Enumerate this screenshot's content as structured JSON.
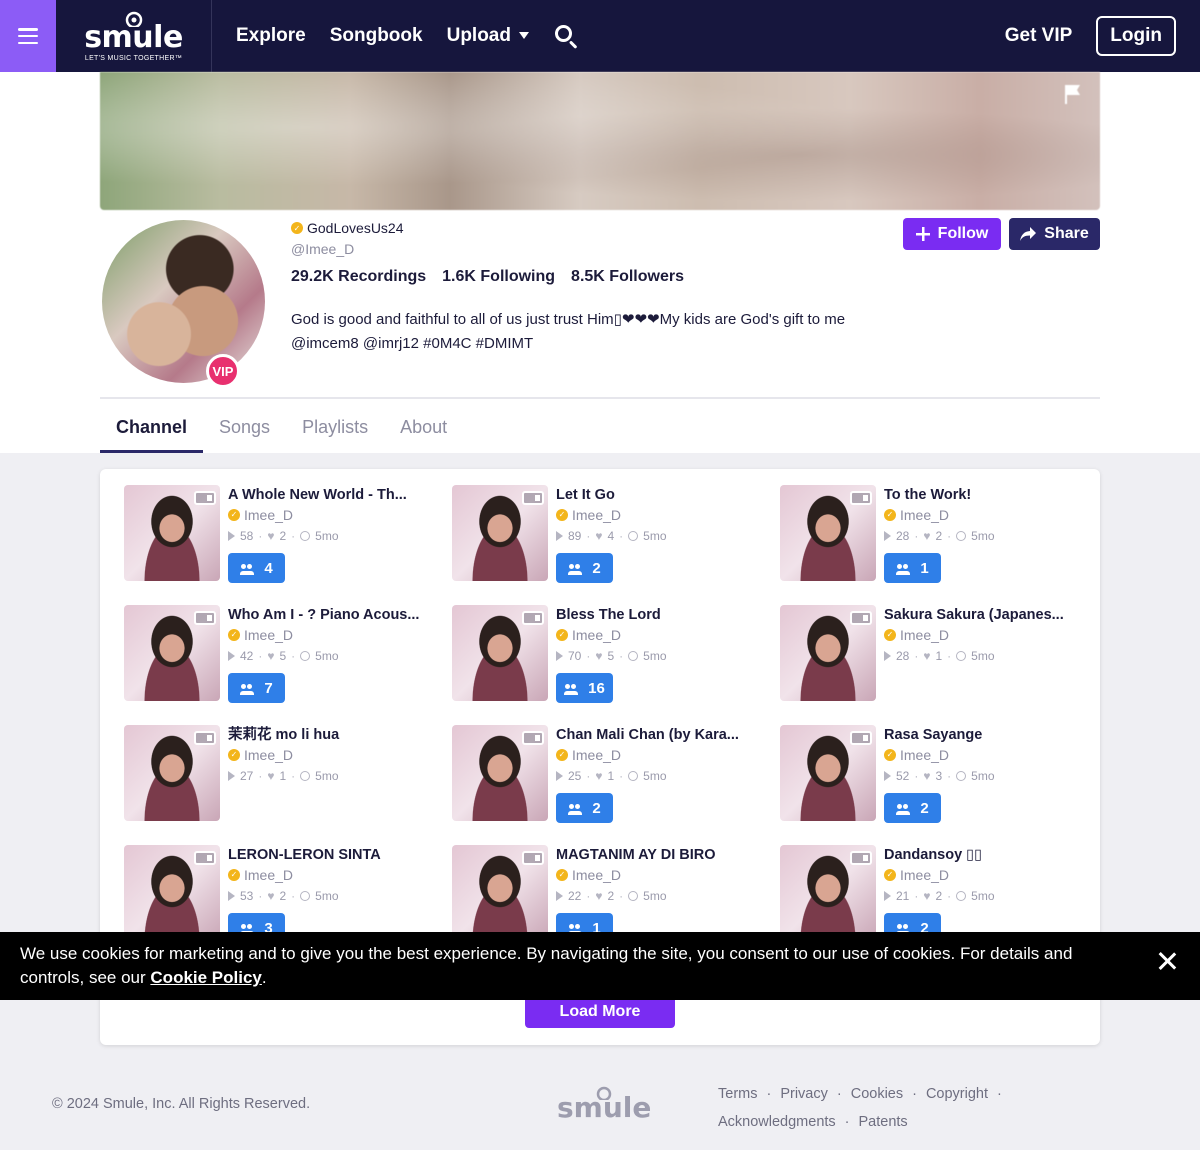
{
  "header": {
    "logo_word": "smule",
    "logo_tagline": "LET'S MUSIC TOGETHER™",
    "nav": {
      "explore": "Explore",
      "songbook": "Songbook",
      "upload": "Upload"
    },
    "get_vip": "Get VIP",
    "login": "Login"
  },
  "profile": {
    "display_name": "GodLovesUs24",
    "handle": "@Imee_D",
    "vip_badge": "VIP",
    "stats": {
      "recordings": "29.2K Recordings",
      "following": "1.6K Following",
      "followers": "8.5K Followers"
    },
    "bio": "God is good and faithful to all of us just trust Him▯❤❤❤My kids are God's gift to me @imcem8 @imrj12 #0M4C #DMIMT",
    "follow_label": "Follow",
    "share_label": "Share"
  },
  "tabs": [
    {
      "label": "Channel",
      "active": true
    },
    {
      "label": "Songs",
      "active": false
    },
    {
      "label": "Playlists",
      "active": false
    },
    {
      "label": "About",
      "active": false
    }
  ],
  "recordings": [
    {
      "title": "A Whole New World - Th...",
      "artist": "Imee_D",
      "plays": "58",
      "loves": "2",
      "age": "5mo",
      "collabs": "4"
    },
    {
      "title": "Let It Go",
      "artist": "Imee_D",
      "plays": "89",
      "loves": "4",
      "age": "5mo",
      "collabs": "2"
    },
    {
      "title": "To the Work!",
      "artist": "Imee_D",
      "plays": "28",
      "loves": "2",
      "age": "5mo",
      "collabs": "1"
    },
    {
      "title": "Who Am I - ? Piano Acous...",
      "artist": "Imee_D",
      "plays": "42",
      "loves": "5",
      "age": "5mo",
      "collabs": "7"
    },
    {
      "title": "Bless The Lord",
      "artist": "Imee_D",
      "plays": "70",
      "loves": "5",
      "age": "5mo",
      "collabs": "16"
    },
    {
      "title": "Sakura Sakura (Japanes...",
      "artist": "Imee_D",
      "plays": "28",
      "loves": "1",
      "age": "5mo",
      "collabs": null
    },
    {
      "title": "茉莉花 mo li hua",
      "artist": "Imee_D",
      "plays": "27",
      "loves": "1",
      "age": "5mo",
      "collabs": null
    },
    {
      "title": "Chan Mali Chan (by Kara...",
      "artist": "Imee_D",
      "plays": "25",
      "loves": "1",
      "age": "5mo",
      "collabs": "2"
    },
    {
      "title": "Rasa Sayange",
      "artist": "Imee_D",
      "plays": "52",
      "loves": "3",
      "age": "5mo",
      "collabs": "2"
    },
    {
      "title": "LERON-LERON SINTA",
      "artist": "Imee_D",
      "plays": "53",
      "loves": "2",
      "age": "5mo",
      "collabs": "3"
    },
    {
      "title": "MAGTANIM AY DI BIRO",
      "artist": "Imee_D",
      "plays": "22",
      "loves": "2",
      "age": "5mo",
      "collabs": "1"
    },
    {
      "title": "Dandansoy ▯▯",
      "artist": "Imee_D",
      "plays": "21",
      "loves": "2",
      "age": "5mo",
      "collabs": "2"
    }
  ],
  "load_more": "Load More",
  "cookie": {
    "text": "We use cookies for marketing and to give you the best experience. By navigating the site, you consent to our use of cookies. For details and controls, see our ",
    "link": "Cookie Policy",
    "end": "."
  },
  "footer": {
    "copyright": "© 2024 Smule, Inc. All Rights Reserved.",
    "logo_word": "smule",
    "links": [
      "Terms",
      "Privacy",
      "Cookies",
      "Copyright",
      "Acknowledgments",
      "Patents"
    ]
  },
  "colors": {
    "header_bg": "#16163d",
    "menu_accent": "#8c5cf6",
    "follow_purple": "#7a2cf2",
    "share_navy": "#2a2868",
    "collab_blue": "#2f7fe8",
    "verified_gold": "#f3b51b",
    "vip_pink": "#e8306f"
  }
}
